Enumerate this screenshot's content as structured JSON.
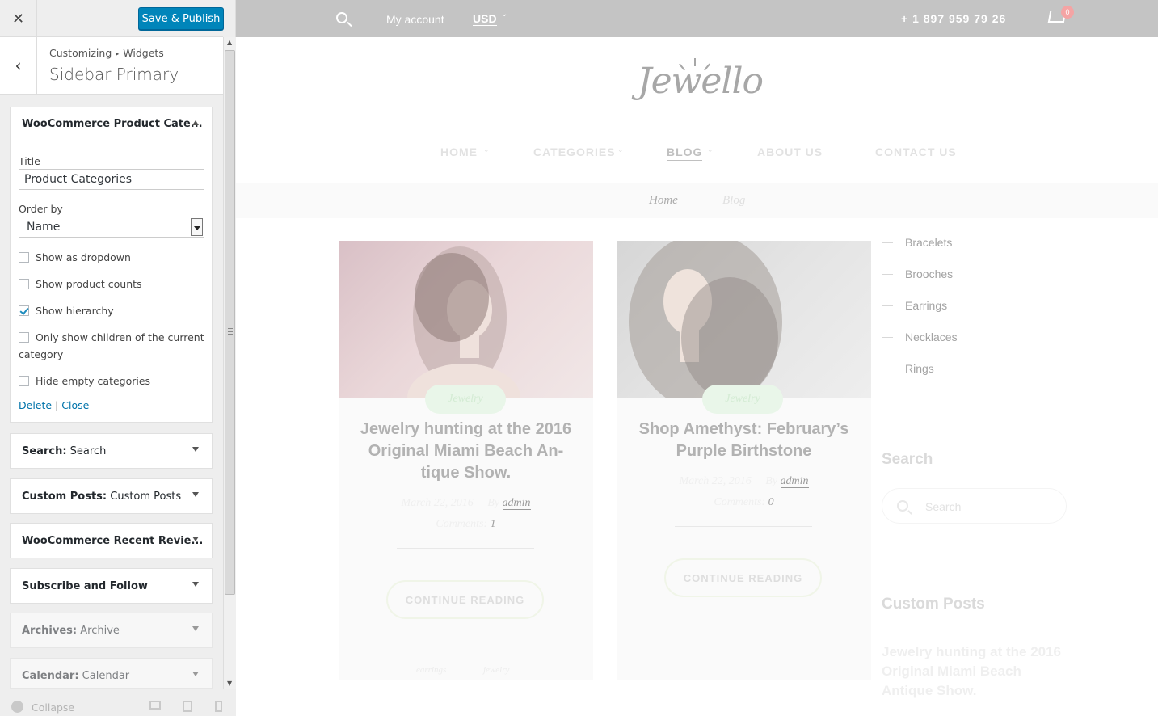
{
  "customizer": {
    "close_glyph": "✕",
    "save_label": "Save & Publish",
    "back_glyph": "‹",
    "breadcrumb": {
      "root": "Customizing",
      "sep": "▸",
      "current": "Widgets"
    },
    "section_title": "Sidebar Primary",
    "open_widget": {
      "header": "WooCommerce Product Cate...",
      "title_label": "Title",
      "title_value": "Product Categories",
      "orderby_label": "Order by",
      "orderby_value": "Name",
      "checkboxes": [
        {
          "label": "Show as dropdown",
          "checked": false
        },
        {
          "label": "Show product counts",
          "checked": false
        },
        {
          "label": "Show hierarchy",
          "checked": true
        },
        {
          "label": "Only show children of the current category",
          "checked": false
        },
        {
          "label": "Hide empty categories",
          "checked": false
        }
      ],
      "delete_label": "Delete",
      "link_sep": "|",
      "close_label": "Close"
    },
    "widgets": [
      {
        "type": "Search:",
        "name": "Search"
      },
      {
        "type": "Custom Posts:",
        "name": "Custom Posts"
      },
      {
        "type": "WooCommerce Recent Revie...",
        "name": ""
      },
      {
        "type": "Subscribe and Follow",
        "name": ""
      },
      {
        "type": "Archives:",
        "name": "Archive"
      },
      {
        "type": "Calendar:",
        "name": "Calendar"
      }
    ],
    "footer": {
      "collapse_label": "Collapse"
    }
  },
  "preview": {
    "topbar": {
      "account": "My account",
      "currency": "USD",
      "currency_chev": "⌄",
      "phone": "+ 1 897 959 79 26",
      "cart_count": "0"
    },
    "logo": "Jewello",
    "nav": [
      {
        "label": "HOME",
        "chev": "⌄"
      },
      {
        "label": "CATEGORIES",
        "chev": "⌄"
      },
      {
        "label": "BLOG",
        "chev": "⌄"
      },
      {
        "label": "ABOUT US",
        "chev": ""
      },
      {
        "label": "CONTACT US",
        "chev": ""
      }
    ],
    "breadcrumbs": [
      "Home",
      "Blog"
    ],
    "posts": [
      {
        "tag": "Jewelry",
        "title": "Jewelry hunting at the 2016 Original Miami Beach An-tique Show.",
        "date": "March 22, 2016",
        "by": "By",
        "author": "admin",
        "comments_label": "Comments:",
        "comments": "1",
        "read_more": "CONTINUE READING",
        "footer_tags": [
          "earrings",
          "jewelry"
        ]
      },
      {
        "tag": "Jewelry",
        "title": "Shop Amethyst: February’s Purple Birthstone",
        "date": "March 22, 2016",
        "by": "By",
        "author": "admin",
        "comments_label": "Comments:",
        "comments": "0",
        "read_more": "CONTINUE READING"
      }
    ],
    "sidebar": {
      "categories": [
        "Bracelets",
        "Brooches",
        "Earrings",
        "Necklaces",
        "Rings"
      ],
      "search_heading": "Search",
      "search_placeholder": "Search",
      "custom_posts_heading": "Custom Posts",
      "custom_post_title": "Jewelry hunting at the 2016 Original Miami Beach Antique Show."
    }
  },
  "colors": {
    "primary_button": "#0085ba",
    "link": "#0073aa",
    "topbar": "#c4c4c4"
  }
}
